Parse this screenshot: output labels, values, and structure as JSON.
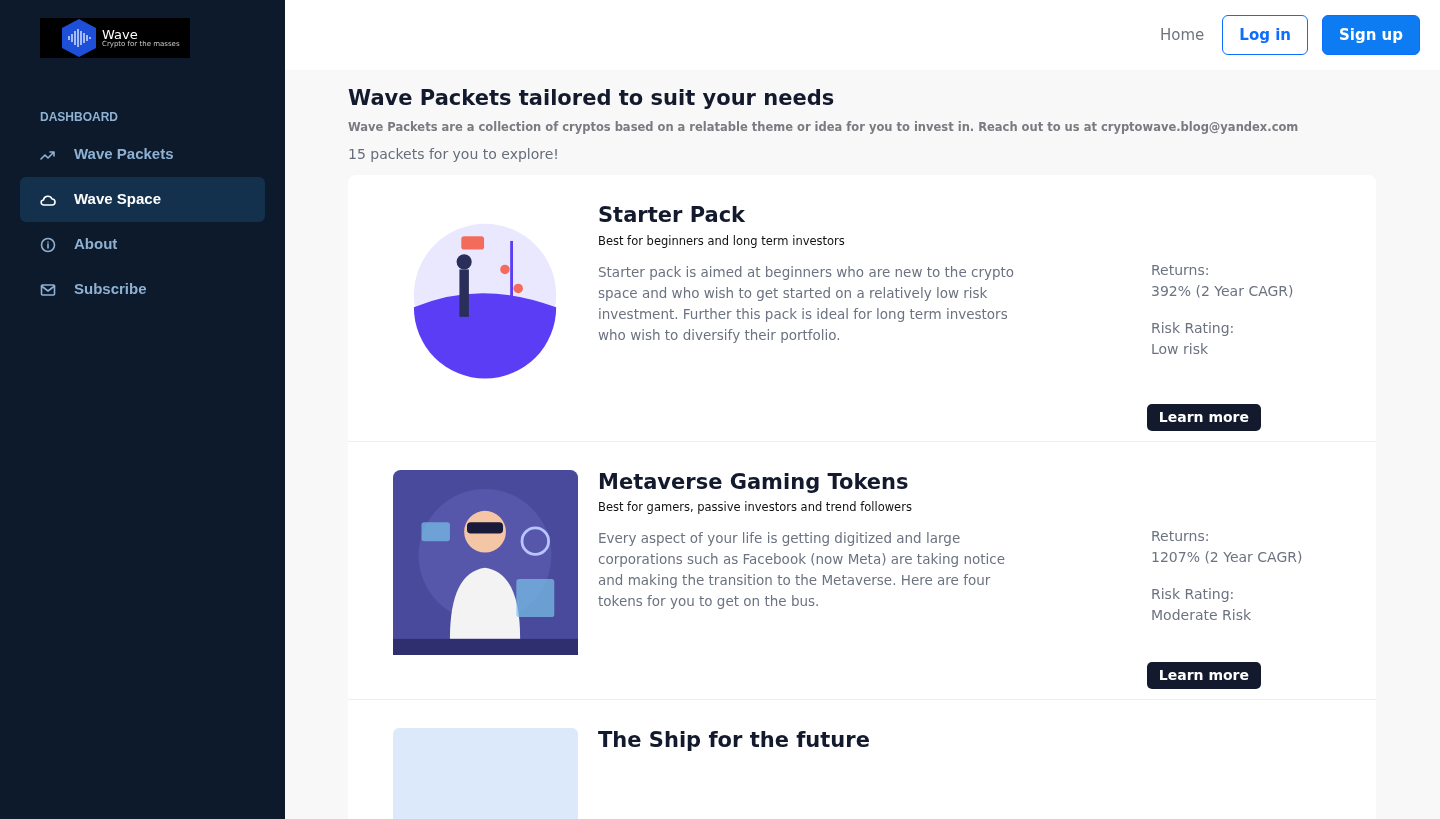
{
  "logo": {
    "title": "Wave",
    "tagline": "Crypto for the masses"
  },
  "sidebar": {
    "section": "DASHBOARD",
    "items": [
      {
        "label": "Wave Packets",
        "selected": false
      },
      {
        "label": "Wave Space",
        "selected": true
      },
      {
        "label": "About",
        "selected": false
      },
      {
        "label": "Subscribe",
        "selected": false
      }
    ]
  },
  "topbar": {
    "links": [
      "Home"
    ],
    "login": "Log in",
    "signup": "Sign up"
  },
  "header": {
    "title": "Wave Packets tailored to suit your needs",
    "description": "Wave Packets are a collection of cryptos based on a relatable theme or idea for you to invest in. Reach out to us at cryptowave.blog@yandex.com",
    "count": "15 packets for you to explore!"
  },
  "packets": [
    {
      "title": "Starter Pack",
      "subtitle": "Best for beginners and long term investors",
      "description": "Starter pack is aimed at beginners who are new to the crypto space and who wish to get started on a relatively low risk investment. Further this pack is ideal for long term investors who wish to diversify their portfolio.",
      "returns_label": "Returns:",
      "returns": "392% (2 Year CAGR)",
      "risk_label": "Risk Rating:",
      "risk": "Low risk",
      "button": "Learn more"
    },
    {
      "title": "Metaverse Gaming Tokens",
      "subtitle": "Best for gamers, passive investors and trend followers",
      "description": "Every aspect of your life is getting digitized and large corporations such as Facebook (now Meta) are taking notice and making the transition to the Metaverse. Here are four tokens for you to get on the bus.",
      "returns_label": "Returns:",
      "returns": "1207% (2 Year CAGR)",
      "risk_label": "Risk Rating:",
      "risk": "Moderate Risk",
      "button": "Learn more"
    },
    {
      "title": "The Ship for the future"
    }
  ]
}
